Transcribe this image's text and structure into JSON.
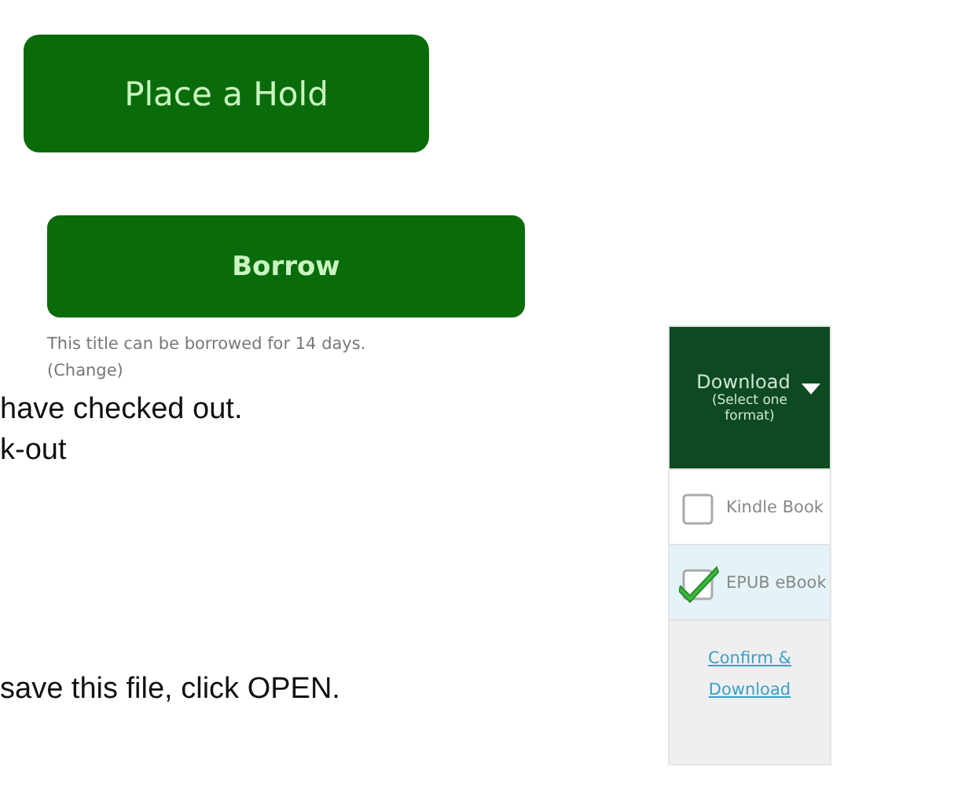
{
  "hold_button": {
    "label": "Place a Hold"
  },
  "borrow": {
    "button": "Borrow",
    "note": "This title can be borrowed for 14 days.",
    "change_link": "(Change)"
  },
  "document_lines": [
    "have checked out.",
    "k-out",
    "save this file, click OPEN."
  ],
  "download_panel": {
    "title": "Download",
    "subtitle": "(Select one format)",
    "formats": [
      {
        "label": "Kindle Book",
        "checked": false
      },
      {
        "label": "EPUB eBook",
        "checked": true
      }
    ],
    "confirm_link": "Confirm & Download"
  }
}
